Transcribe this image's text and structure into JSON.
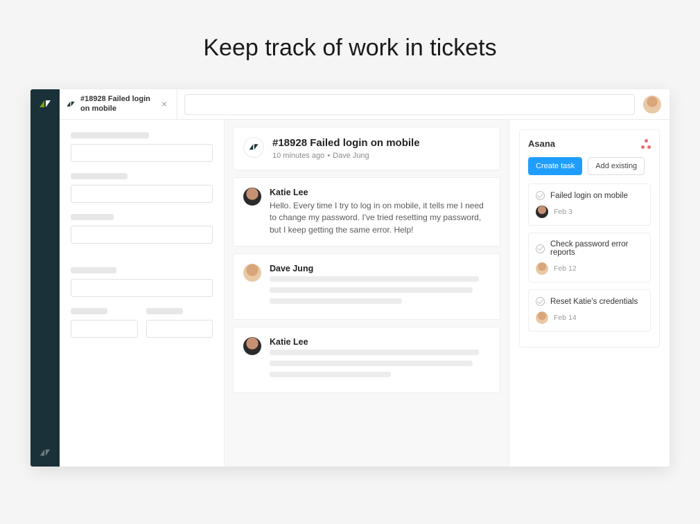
{
  "heroTitle": "Keep track of work in tickets",
  "tab": {
    "titleLine1": "#18928 Failed login",
    "titleLine2": "on mobile"
  },
  "ticket": {
    "title": "#18928 Failed login on mobile",
    "time": "10 minutes ago",
    "author": "Dave Jung"
  },
  "messages": [
    {
      "author": "Katie Lee",
      "avatar": "katie",
      "text": "Hello. Every time I try to log in on mobile, it tells me I need to change my password. I've tried resetting my password, but I keep getting the same error. Help!",
      "placeholder": false
    },
    {
      "author": "Dave Jung",
      "avatar": "dave",
      "text": "",
      "placeholder": true
    },
    {
      "author": "Katie Lee",
      "avatar": "katie",
      "text": "",
      "placeholder": true
    }
  ],
  "asana": {
    "panelTitle": "Asana",
    "createTask": "Create task",
    "addExisting": "Add existing",
    "tasks": [
      {
        "title": "Failed login on mobile",
        "date": "Feb 3",
        "avatar": "katie"
      },
      {
        "title": "Check password error reports",
        "date": "Feb 12",
        "avatar": "dave"
      },
      {
        "title": "Reset Katie's credentials",
        "date": "Feb 14",
        "avatar": "dave"
      }
    ]
  }
}
